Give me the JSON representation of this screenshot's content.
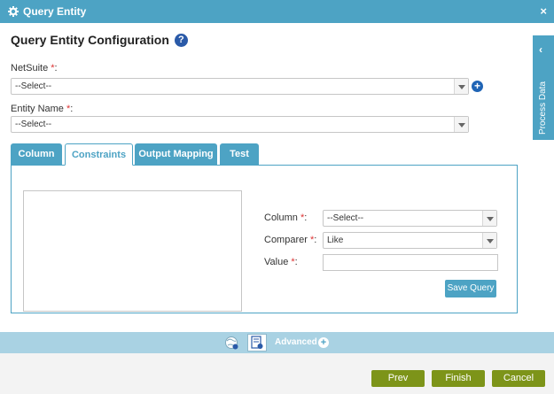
{
  "window": {
    "title": "Query Entity",
    "close_glyph": "×"
  },
  "heading": {
    "title": "Query Entity Configuration",
    "help_glyph": "?"
  },
  "fields": {
    "netsuite": {
      "label": "NetSuite",
      "required": "*",
      "colon": ":",
      "value": "--Select--"
    },
    "entity_name": {
      "label": "Entity Name",
      "required": "*",
      "colon": ":",
      "value": "--Select--"
    },
    "add_glyph": "+"
  },
  "tabs": [
    {
      "label": "Column",
      "active": false
    },
    {
      "label": "Constraints",
      "active": true
    },
    {
      "label": "Output Mapping",
      "active": false
    },
    {
      "label": "Test",
      "active": false
    }
  ],
  "constraints": {
    "column": {
      "label": "Column",
      "required": "*",
      "colon": ":",
      "value": "--Select--"
    },
    "comparer": {
      "label": "Comparer",
      "required": "*",
      "colon": ":",
      "value": "Like"
    },
    "value": {
      "label": "Value",
      "required": "*",
      "colon": ":",
      "value": ""
    },
    "save_query": "Save Query"
  },
  "side_panel": {
    "label": "Process Data",
    "chevron": "‹"
  },
  "advanced": {
    "label": "Advanced",
    "plus_glyph": "+"
  },
  "footer": {
    "prev": "Prev",
    "finish": "Finish",
    "cancel": "Cancel"
  },
  "colors": {
    "accent": "#4da3c4",
    "nav_button": "#7d9419",
    "required": "#dd3333",
    "help": "#2a5aa8"
  },
  "icons": [
    "gear-icon",
    "close-icon",
    "help-icon",
    "add-icon",
    "dropdown-arrow-icon",
    "chevron-left-icon",
    "globe-gear-icon",
    "document-icon",
    "plus-icon"
  ]
}
